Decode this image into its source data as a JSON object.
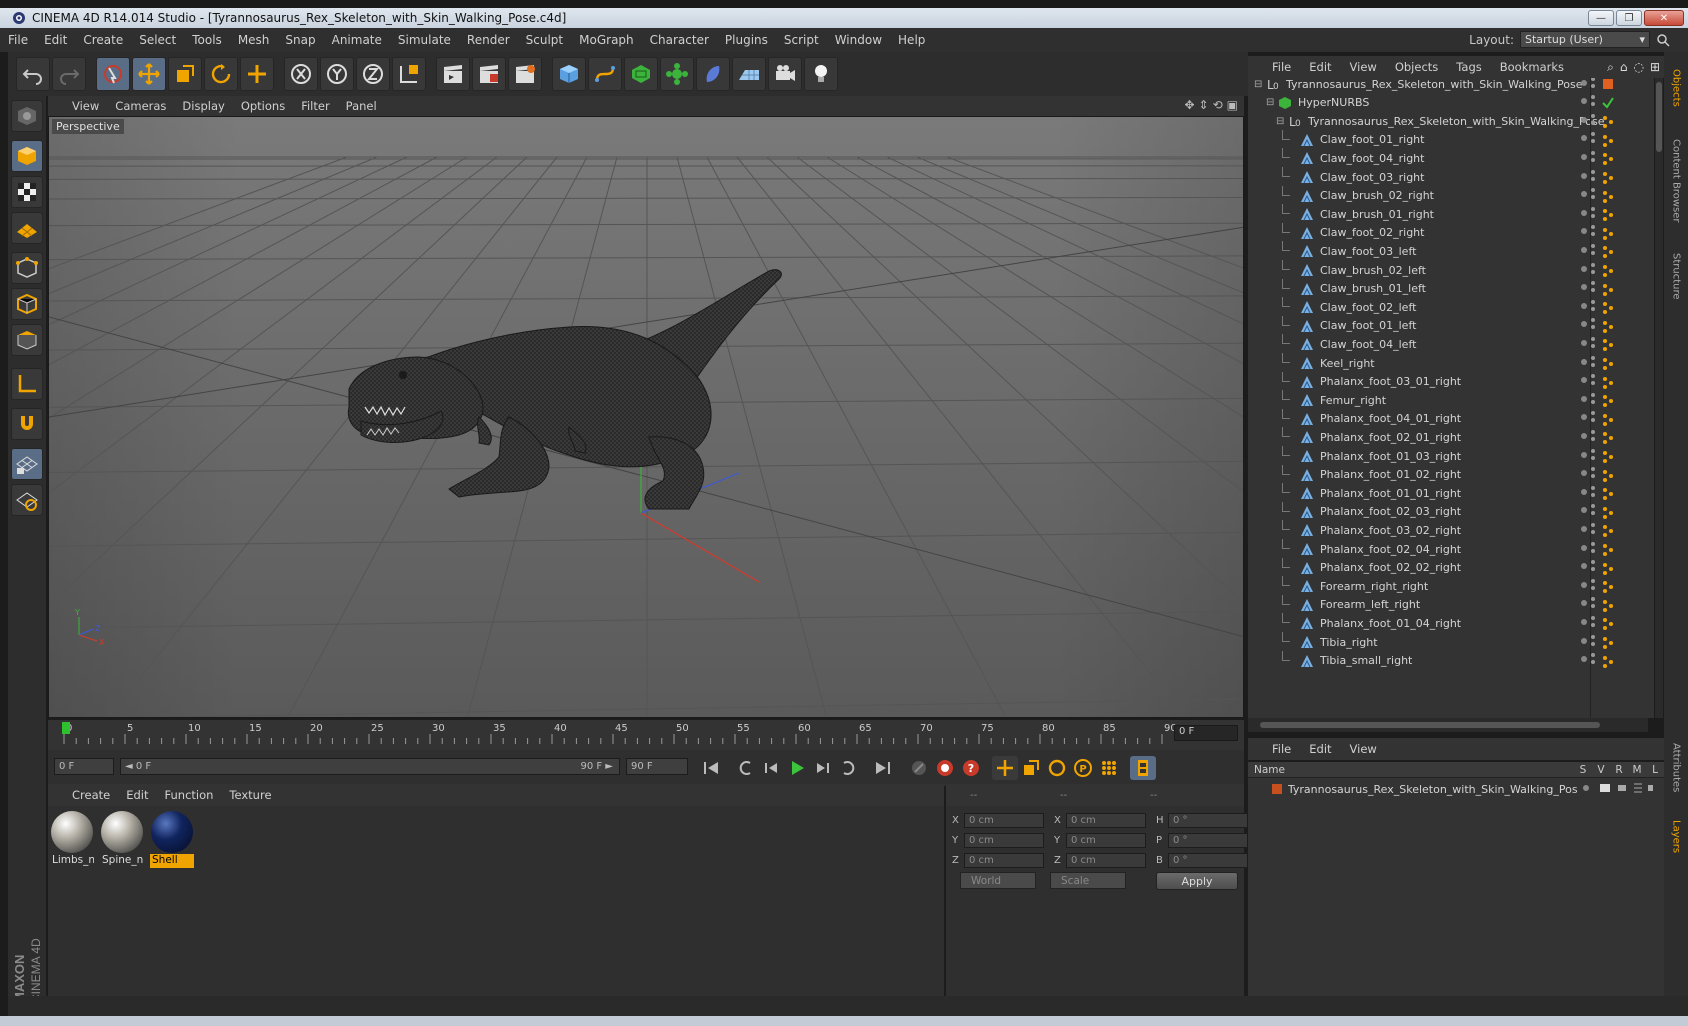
{
  "window": {
    "title": "CINEMA 4D R14.014 Studio - [Tyrannosaurus_Rex_Skeleton_with_Skin_Walking_Pose.c4d]",
    "minimize": "—",
    "restore": "❐",
    "close": "✕"
  },
  "menubar": {
    "items": [
      "File",
      "Edit",
      "Create",
      "Select",
      "Tools",
      "Mesh",
      "Snap",
      "Animate",
      "Simulate",
      "Render",
      "Sculpt",
      "MoGraph",
      "Character",
      "Plugins",
      "Script",
      "Window",
      "Help"
    ],
    "layout_label": "Layout:",
    "layout_value": "Startup (User)"
  },
  "viewport": {
    "menu": [
      "View",
      "Cameras",
      "Display",
      "Options",
      "Filter",
      "Panel"
    ],
    "label": "Perspective",
    "axis_labels": {
      "x": "X",
      "y": "Y",
      "z": "Z"
    }
  },
  "timeline": {
    "ticks": [
      "0",
      "5",
      "10",
      "15",
      "20",
      "25",
      "30",
      "35",
      "40",
      "45",
      "50",
      "55",
      "60",
      "65",
      "70",
      "75",
      "80",
      "85",
      "90"
    ],
    "current_frame": "0 F"
  },
  "transport": {
    "start_field": "0 F",
    "range_start": "◄ 0 F",
    "range_end": "90 F ►",
    "end_field": "90 F"
  },
  "material_manager": {
    "menu": [
      "Create",
      "Edit",
      "Function",
      "Texture"
    ],
    "materials": [
      {
        "name": "Limbs_n",
        "color": "#b8b4aa",
        "selected": false
      },
      {
        "name": "Spine_n",
        "color": "#b8b4aa",
        "selected": false
      },
      {
        "name": "Shell",
        "color": "#10245e",
        "selected": true
      }
    ]
  },
  "coordinates": {
    "headers": [
      "--",
      "--",
      "--"
    ],
    "rows": [
      {
        "l1": "X",
        "v1": "0 cm",
        "l2": "X",
        "v2": "0 cm",
        "l3": "H",
        "v3": "0 °"
      },
      {
        "l1": "Y",
        "v1": "0 cm",
        "l2": "Y",
        "v2": "0 cm",
        "l3": "P",
        "v3": "0 °"
      },
      {
        "l1": "Z",
        "v1": "0 cm",
        "l2": "Z",
        "v2": "0 cm",
        "l3": "B",
        "v3": "0 °"
      }
    ],
    "mode1": "World",
    "mode2": "Scale",
    "apply": "Apply"
  },
  "object_manager": {
    "menu": [
      "File",
      "Edit",
      "View",
      "Objects",
      "Tags",
      "Bookmarks"
    ],
    "objects": [
      {
        "name": "Tyrannosaurus_Rex_Skeleton_with_Skin_Walking_Pose",
        "indent": 0,
        "type": "null",
        "tag": "material"
      },
      {
        "name": "HyperNURBS",
        "indent": 1,
        "type": "nurbs",
        "tag": "check"
      },
      {
        "name": "Tyrannosaurus_Rex_Skeleton_with_Skin_Walking_Pose",
        "indent": 2,
        "type": "null",
        "tag": "phong"
      },
      {
        "name": "Claw_foot_01_right",
        "indent": 3,
        "type": "poly",
        "tag": "phong"
      },
      {
        "name": "Claw_foot_04_right",
        "indent": 3,
        "type": "poly",
        "tag": "phong"
      },
      {
        "name": "Claw_foot_03_right",
        "indent": 3,
        "type": "poly",
        "tag": "phong"
      },
      {
        "name": "Claw_brush_02_right",
        "indent": 3,
        "type": "poly",
        "tag": "phong"
      },
      {
        "name": "Claw_brush_01_right",
        "indent": 3,
        "type": "poly",
        "tag": "phong"
      },
      {
        "name": "Claw_foot_02_right",
        "indent": 3,
        "type": "poly",
        "tag": "phong"
      },
      {
        "name": "Claw_foot_03_left",
        "indent": 3,
        "type": "poly",
        "tag": "phong"
      },
      {
        "name": "Claw_brush_02_left",
        "indent": 3,
        "type": "poly",
        "tag": "phong"
      },
      {
        "name": "Claw_brush_01_left",
        "indent": 3,
        "type": "poly",
        "tag": "phong"
      },
      {
        "name": "Claw_foot_02_left",
        "indent": 3,
        "type": "poly",
        "tag": "phong"
      },
      {
        "name": "Claw_foot_01_left",
        "indent": 3,
        "type": "poly",
        "tag": "phong"
      },
      {
        "name": "Claw_foot_04_left",
        "indent": 3,
        "type": "poly",
        "tag": "phong"
      },
      {
        "name": "Keel_right",
        "indent": 3,
        "type": "poly",
        "tag": "phong"
      },
      {
        "name": "Phalanx_foot_03_01_right",
        "indent": 3,
        "type": "poly",
        "tag": "phong"
      },
      {
        "name": "Femur_right",
        "indent": 3,
        "type": "poly",
        "tag": "phong"
      },
      {
        "name": "Phalanx_foot_04_01_right",
        "indent": 3,
        "type": "poly",
        "tag": "phong"
      },
      {
        "name": "Phalanx_foot_02_01_right",
        "indent": 3,
        "type": "poly",
        "tag": "phong"
      },
      {
        "name": "Phalanx_foot_01_03_right",
        "indent": 3,
        "type": "poly",
        "tag": "phong"
      },
      {
        "name": "Phalanx_foot_01_02_right",
        "indent": 3,
        "type": "poly",
        "tag": "phong"
      },
      {
        "name": "Phalanx_foot_01_01_right",
        "indent": 3,
        "type": "poly",
        "tag": "phong"
      },
      {
        "name": "Phalanx_foot_02_03_right",
        "indent": 3,
        "type": "poly",
        "tag": "phong"
      },
      {
        "name": "Phalanx_foot_03_02_right",
        "indent": 3,
        "type": "poly",
        "tag": "phong"
      },
      {
        "name": "Phalanx_foot_02_04_right",
        "indent": 3,
        "type": "poly",
        "tag": "phong"
      },
      {
        "name": "Phalanx_foot_02_02_right",
        "indent": 3,
        "type": "poly",
        "tag": "phong"
      },
      {
        "name": "Forearm_right_right",
        "indent": 3,
        "type": "poly",
        "tag": "phong"
      },
      {
        "name": "Forearm_left_right",
        "indent": 3,
        "type": "poly",
        "tag": "phong"
      },
      {
        "name": "Phalanx_foot_01_04_right",
        "indent": 3,
        "type": "poly",
        "tag": "phong"
      },
      {
        "name": "Tibia_right",
        "indent": 3,
        "type": "poly",
        "tag": "phong"
      },
      {
        "name": "Tibia_small_right",
        "indent": 3,
        "type": "poly",
        "tag": "phong"
      }
    ]
  },
  "layer_manager": {
    "menu": [
      "File",
      "Edit",
      "View"
    ],
    "columns": [
      "Name",
      "S",
      "V",
      "R",
      "M",
      "L"
    ],
    "layers": [
      {
        "name": "Tyrannosaurus_Rex_Skeleton_with_Skin_Walking_Pose",
        "color": "#c8501e"
      }
    ]
  },
  "right_tabs": [
    "Objects",
    "Content Browser",
    "Structure",
    "Attributes",
    "Layers"
  ],
  "branding": {
    "line1": "MAXON",
    "line2": "CINEMA 4D"
  },
  "colors": {
    "accent_orange": "#f0a400",
    "selected_tool": "#5a6d86",
    "axis_x": "#d63a2a",
    "axis_y": "#3cb43c",
    "axis_z": "#3c5ad6"
  }
}
